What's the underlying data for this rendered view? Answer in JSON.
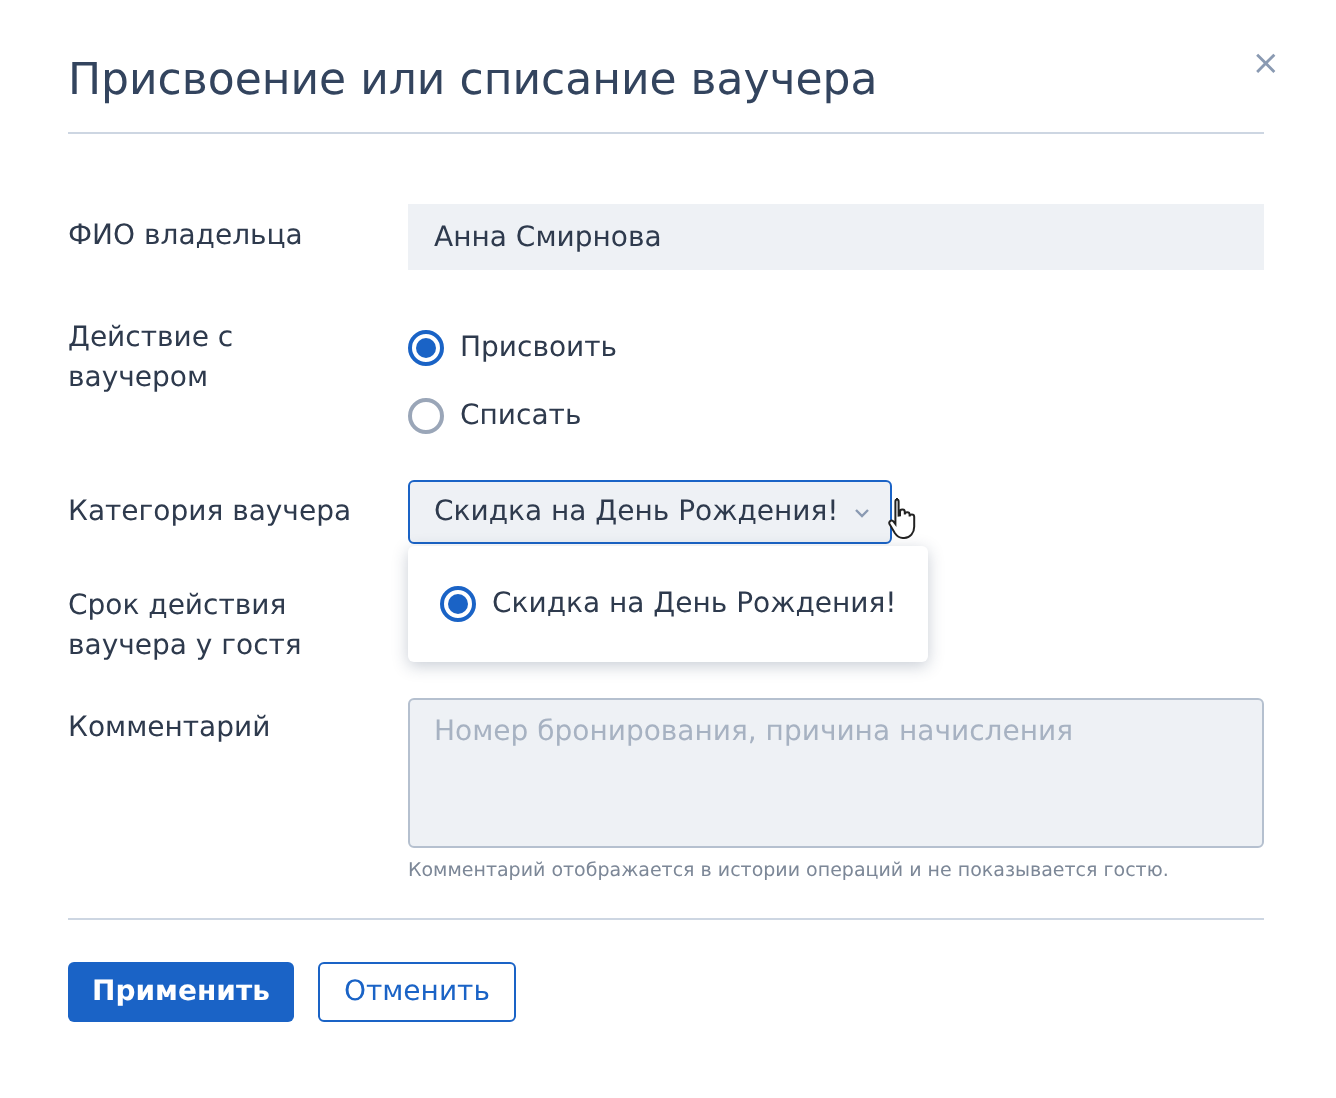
{
  "dialog": {
    "title": "Присвоение или списание ваучера",
    "close": "×"
  },
  "owner": {
    "label": "ФИО владельца",
    "value": "Анна Смирнова"
  },
  "action": {
    "label": "Действие с ваучером",
    "options": [
      {
        "label": "Присвоить",
        "selected": true
      },
      {
        "label": "Списать",
        "selected": false
      }
    ]
  },
  "category": {
    "label": "Категория ваучера",
    "value": "Скидка на День Рождения!",
    "expanded": true,
    "options": [
      {
        "label": "Скидка на День Рождения!",
        "selected": true
      }
    ]
  },
  "validity": {
    "label": "Срок действия ваучера у гостя"
  },
  "comment": {
    "label": "Комментарий",
    "placeholder": "Номер бронирования, причина начисления",
    "hint": "Комментарий отображается в истории операций и не показывается гостю."
  },
  "buttons": [
    {
      "label": "Применить",
      "kind": "primary"
    },
    {
      "label": "Отменить",
      "kind": "secondary"
    }
  ]
}
